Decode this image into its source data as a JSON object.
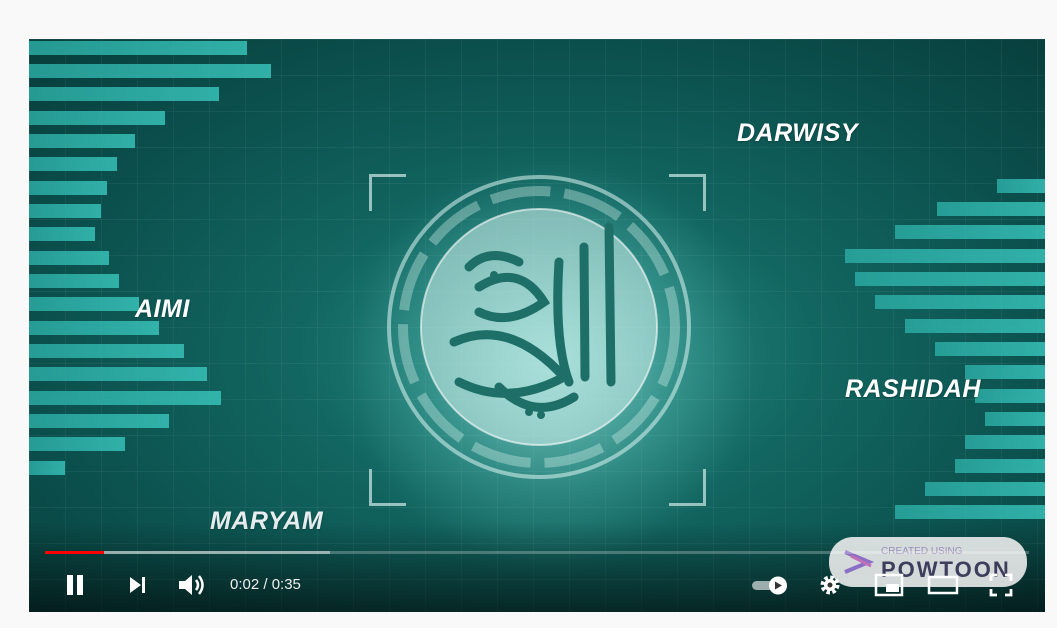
{
  "video": {
    "names": {
      "darwisy": "DARWISY",
      "aimi": "AIMI",
      "rashidah": "RASHIDAH",
      "maryam": "MARYAM"
    },
    "progress_played": 0.06,
    "progress_loaded": 0.29
  },
  "controls": {
    "time": "0:02 / 0:35",
    "autoplay_on": true
  },
  "watermark": {
    "small": "CREATED USING",
    "big": "POWTOON"
  },
  "colors": {
    "accent": "#ff0000",
    "bar_teal": "#37c1b8",
    "bg_teal": "#126661"
  },
  "icons": [
    "pause-icon",
    "next-icon",
    "volume-icon",
    "autoplay-toggle",
    "gear-icon",
    "miniplayer-icon",
    "theater-icon",
    "fullscreen-icon"
  ]
}
